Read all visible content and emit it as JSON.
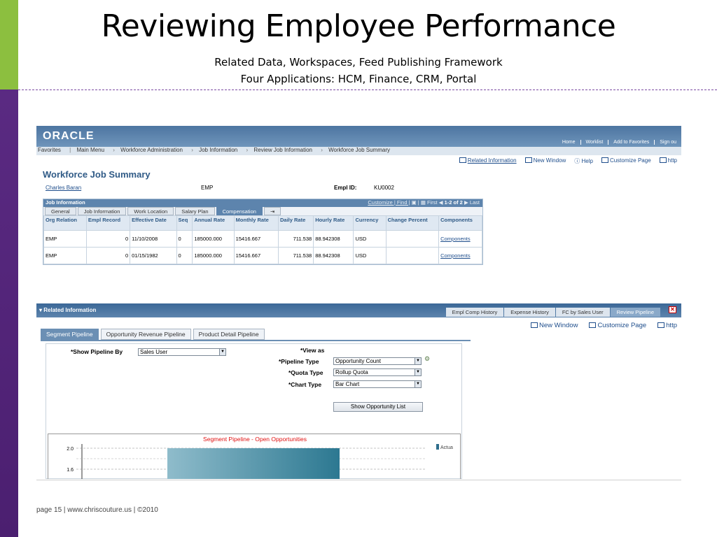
{
  "slide": {
    "title": "Reviewing Employee Performance",
    "subtitle1": "Related Data, Workspaces, Feed Publishing Framework",
    "subtitle2": "Four Applications: HCM, Finance, CRM, Portal",
    "footer": "page 15 | www.chriscouture.us | ©2010"
  },
  "app": {
    "logo": "ORACLE",
    "top_links": [
      "Home",
      "Worklist",
      "Add to Favorites",
      "Sign ou"
    ],
    "breadcrumb": [
      "Favorites",
      "Main Menu",
      "Workforce Administration",
      "Job Information",
      "Review Job Information",
      "Workforce Job Summary"
    ],
    "actions": {
      "related": "Related Information",
      "new_window": "New Window",
      "help": "Help",
      "customize": "Customize Page",
      "http": "http"
    },
    "page_title": "Workforce Job Summary",
    "employee": {
      "name": "Charles Baran",
      "type": "EMP",
      "id_label": "Empl ID:",
      "id": "KU0002"
    }
  },
  "job_grid": {
    "title": "Job Information",
    "nav": "Customize | Find |",
    "paging": "First",
    "count": "1-2 of 2",
    "last": "Last",
    "tabs": [
      "General",
      "Job Information",
      "Work Location",
      "Salary Plan",
      "Compensation"
    ],
    "active_tab": 4,
    "headers": [
      "Org Relation",
      "Empl Record",
      "Effective Date",
      "Seq",
      "Annual Rate",
      "Monthly Rate",
      "Daily Rate",
      "Hourly Rate",
      "Currency",
      "Change Percent",
      "Components"
    ],
    "rows": [
      [
        "EMP",
        "0",
        "11/10/2008",
        "0",
        "185000.000",
        "15416.667",
        "711.538",
        "88.942308",
        "USD",
        "",
        "Components"
      ],
      [
        "EMP",
        "0",
        "01/15/1982",
        "0",
        "185000.000",
        "15416.667",
        "711.538",
        "88.942308",
        "USD",
        "",
        "Components"
      ]
    ]
  },
  "related": {
    "label": "Related Information",
    "tabs": [
      "Empl Comp History",
      "Expense History",
      "FC by Sales User",
      "Review Pipeline"
    ],
    "active_tab": 3,
    "actions": {
      "new_window": "New Window",
      "customize": "Customize Page",
      "http": "http"
    }
  },
  "pipeline": {
    "tabs": [
      "Segment Pipeline",
      "Opportunity Revenue Pipeline",
      "Product Detail Pipeline"
    ],
    "active_tab": 0,
    "show_by_label": "*Show Pipeline By",
    "show_by_value": "Sales User",
    "view_as_label": "*View as",
    "pipeline_type_label": "*Pipeline Type",
    "pipeline_type_value": "Opportunity Count",
    "quota_type_label": "*Quota Type",
    "quota_type_value": "Rollup Quota",
    "chart_type_label": "*Chart Type",
    "chart_type_value": "Bar Chart",
    "button": "Show Opportunity List"
  },
  "chart_data": {
    "type": "bar",
    "title": "Segment Pipeline - Open Opportunities",
    "yticks": [
      "2.0",
      "1.6"
    ],
    "series": [
      {
        "name": "Actual",
        "values": [
          2.0
        ]
      }
    ],
    "legend_text": "Actua",
    "ylim_visible": [
      1.4,
      2.0
    ]
  },
  "colors": {
    "green_bar": "#8cbf3f",
    "purple_bar": "#5a2a82",
    "oracle_blue": "#4d75a1",
    "chart_title": "#e01010"
  }
}
